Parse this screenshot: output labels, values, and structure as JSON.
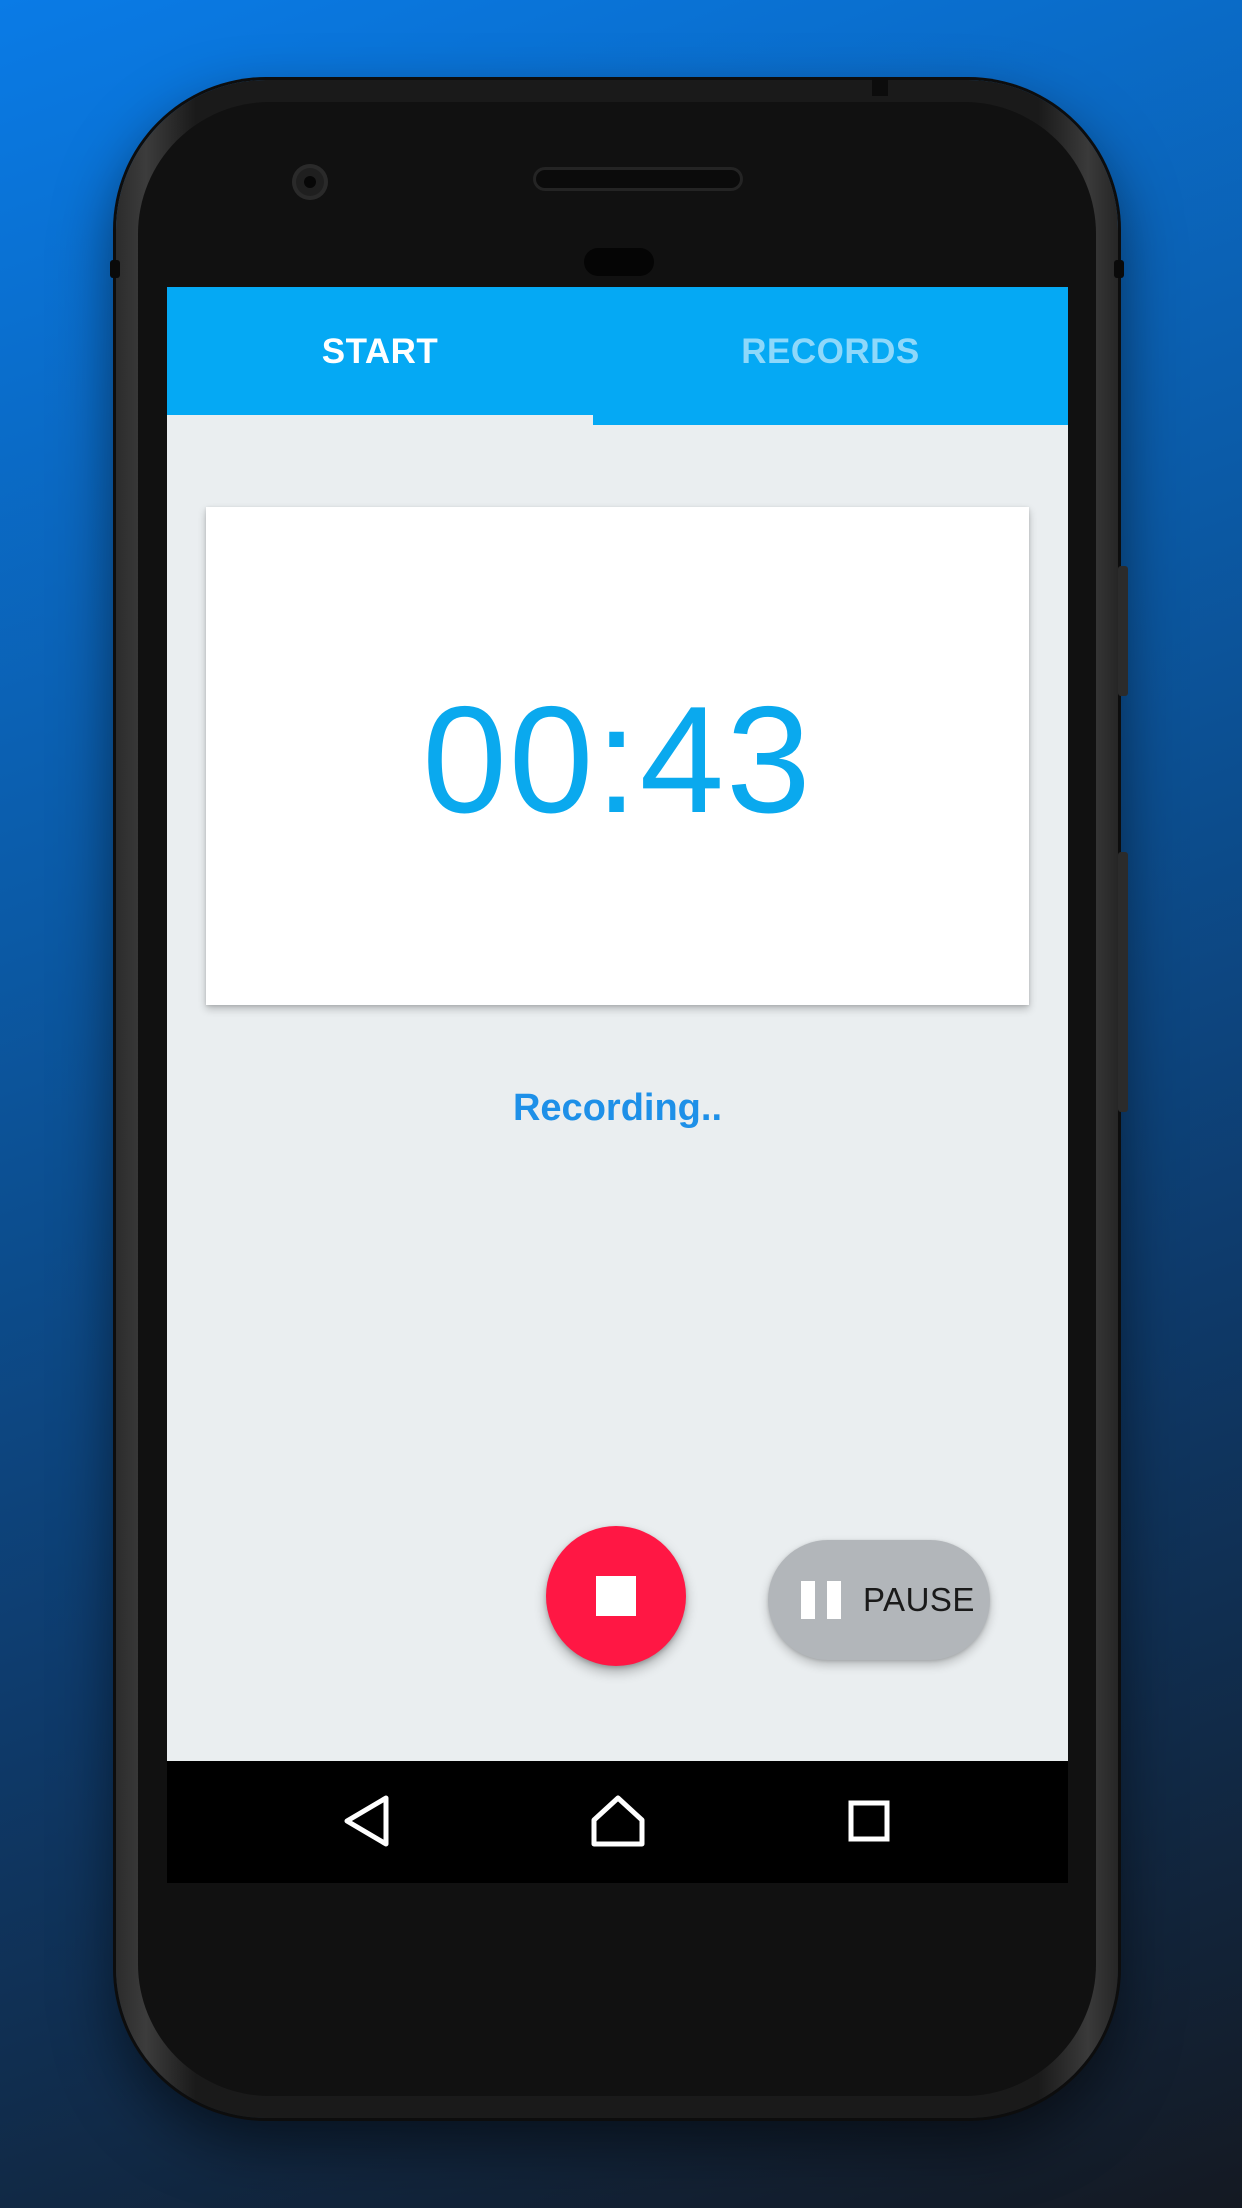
{
  "tabs": [
    {
      "label": "START",
      "active": true
    },
    {
      "label": "RECORDS",
      "active": false
    }
  ],
  "timer": {
    "value": "00:43"
  },
  "status": {
    "text": "Recording.."
  },
  "controls": {
    "stop_icon": "stop-icon",
    "pause_icon": "pause-icon",
    "pause_label": "PAUSE"
  },
  "navigation": {
    "back_icon": "back-triangle-icon",
    "home_icon": "home-icon",
    "recent_icon": "recent-apps-icon"
  },
  "colors": {
    "accent": "#05a9f4",
    "timer": "#0aa9ee",
    "status": "#1e90e8",
    "stop": "#ff1744",
    "pause_bg": "#b2b6ba",
    "content_bg": "#eaeef0"
  }
}
